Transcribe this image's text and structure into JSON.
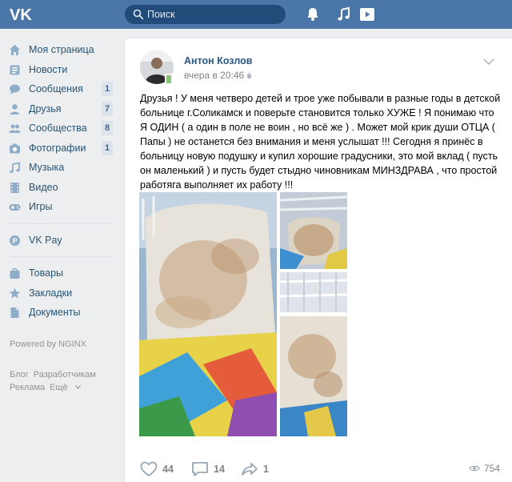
{
  "brand": {
    "logo": "VK"
  },
  "header": {
    "search_placeholder": "Поиск",
    "icons": [
      "notifications-bell-icon",
      "music-note-icon",
      "video-play-icon"
    ]
  },
  "sidebar": {
    "items": [
      {
        "label": "Моя страница",
        "icon": "house-icon"
      },
      {
        "label": "Новости",
        "icon": "news-icon"
      },
      {
        "label": "Сообщения",
        "icon": "chat-bubble-icon",
        "badge": "1"
      },
      {
        "label": "Друзья",
        "icon": "person-icon",
        "badge": "7"
      },
      {
        "label": "Сообщества",
        "icon": "people-icon",
        "badge": "8"
      },
      {
        "label": "Фотографии",
        "icon": "camera-icon",
        "badge": "1"
      },
      {
        "label": "Музыка",
        "icon": "music-note-icon"
      },
      {
        "label": "Видео",
        "icon": "film-icon"
      },
      {
        "label": "Игры",
        "icon": "gamepad-icon"
      }
    ],
    "pay": {
      "label": "VK Pay",
      "icon": "coin-p-icon"
    },
    "items2": [
      {
        "label": "Товары",
        "icon": "shopping-bag-icon"
      },
      {
        "label": "Закладки",
        "icon": "star-icon"
      },
      {
        "label": "Документы",
        "icon": "document-icon"
      }
    ],
    "powered": "Powered by NGINX",
    "footer": [
      "Блог",
      "Разработчикам",
      "Реклама",
      "Ещё"
    ]
  },
  "post": {
    "author": "Антон Козлов",
    "date": "вчера в 20:46",
    "text": "Друзья ! У меня четверо детей и трое уже побывали в разные годы в детской больнице г.Соликамск и поверьте становится только ХУЖЕ ! Я понимаю что Я ОДИН ( а один в поле не воин , но всё же ) . Может мой крик души ОТЦА ( Папы ) не останется без внимания и меня услышат !!! Сегодня я принёс в больницу новую подушку и купил хорошие градусники, это мой вклад ( пусть он маленький ) и пусть будет стыдно чиновникам МИНЗДРАВА , что простой работяга выполняет их работу !!!",
    "likes": "44",
    "comments": "14",
    "shares": "1",
    "views": "754"
  },
  "colors": {
    "header": "#4a76a8",
    "link": "#2a5885",
    "page_bg": "#edeef0"
  }
}
